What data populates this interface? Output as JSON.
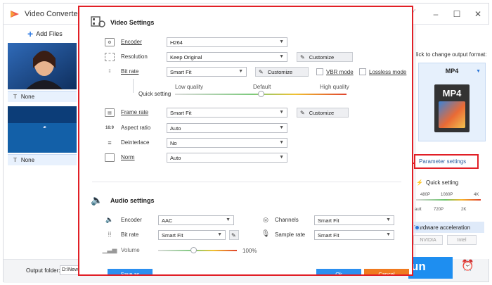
{
  "app": {
    "title": "Video Converter",
    "add_files_label": "Add Files",
    "subtitle_none_1": "None",
    "subtitle_none_2": "None",
    "output_folder_label": "Output folder:",
    "output_folder_value": "D:\\New fo",
    "click_to_change": "lick to change output format:",
    "format_name": "MP4",
    "format_card_label": "MP4",
    "parameter_settings": "Parameter settings",
    "quick_setting": "Quick setting",
    "quality_ticks_top": [
      "480P",
      "1080P",
      "4K"
    ],
    "quality_ticks_bottom": [
      "ault",
      "720P",
      "2K"
    ],
    "hardware_acceleration": "Hardware acceleration",
    "gpu_labels": [
      "NVIDIA",
      "Intel"
    ],
    "run_label": "un"
  },
  "dialog": {
    "video_settings_title": "Video Settings",
    "audio_settings_title": "Audio settings",
    "video": {
      "encoder": {
        "label": "Encoder",
        "value": "H264"
      },
      "resolution": {
        "label": "Resolution",
        "value": "Keep Original",
        "button": "Customize"
      },
      "bitrate": {
        "label": "Bit rate",
        "value": "Smart Fit",
        "button": "Customize",
        "vbr_label": "VBR mode",
        "lossless_label": "Lossless mode"
      },
      "quick_setting": {
        "label": "Quick setting",
        "low": "Low quality",
        "default": "Default",
        "high": "High quality",
        "position": 0.5
      },
      "frame_rate": {
        "label": "Frame rate",
        "value": "Smart Fit",
        "button": "Customize"
      },
      "aspect_ratio": {
        "label": "Aspect ratio",
        "value": "Auto",
        "icon_text": "16:9"
      },
      "deinterlace": {
        "label": "Deinterlace",
        "value": "No"
      },
      "norm": {
        "label": "Norm",
        "value": "Auto"
      }
    },
    "audio": {
      "encoder": {
        "label": "Encoder",
        "value": "AAC"
      },
      "channels": {
        "label": "Channels",
        "value": "Smart Fit"
      },
      "bitrate": {
        "label": "Bit rate",
        "value": "Smart Fit"
      },
      "sample_rate": {
        "label": "Sample rate",
        "value": "Smart Fit"
      },
      "volume": {
        "label": "Volume",
        "value": "100%",
        "position": 0.45
      }
    },
    "footer": {
      "save_as": "Save as",
      "ok": "Ok",
      "cancel": "Cancel"
    }
  },
  "colors": {
    "accent_blue": "#1e8ef0",
    "highlight_red": "#e11f26",
    "cancel_orange": "#f07a1f"
  }
}
